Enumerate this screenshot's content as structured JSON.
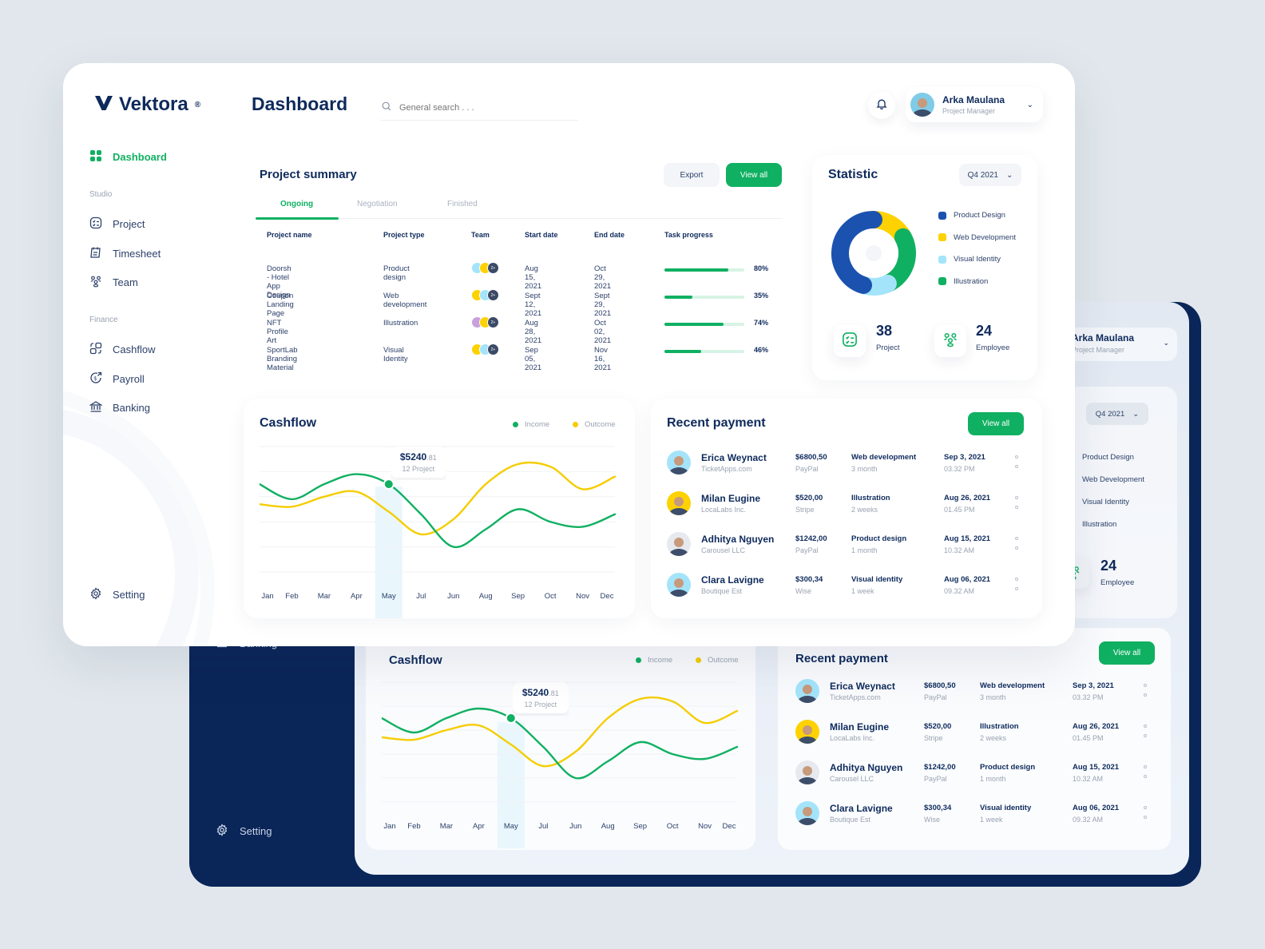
{
  "brand": {
    "name": "Vektora",
    "mark": "®"
  },
  "header": {
    "title": "Dashboard",
    "search_placeholder": "General search . . .",
    "user": {
      "name": "Arka Maulana",
      "role": "Project Manager"
    }
  },
  "sidebar": {
    "active": {
      "label": "Dashboard"
    },
    "sections": [
      {
        "label": "Studio",
        "items": [
          {
            "label": "Project"
          },
          {
            "label": "Timesheet"
          },
          {
            "label": "Team"
          }
        ]
      },
      {
        "label": "Finance",
        "items": [
          {
            "label": "Cashflow"
          },
          {
            "label": "Payroll"
          },
          {
            "label": "Banking"
          }
        ]
      }
    ],
    "setting": {
      "label": "Setting"
    }
  },
  "project_summary": {
    "title": "Project summary",
    "export_label": "Export",
    "view_all_label": "View all",
    "tabs": [
      {
        "label": "Ongoing"
      },
      {
        "label": "Negotiation"
      },
      {
        "label": "Finished"
      }
    ],
    "columns": [
      "Project name",
      "Project type",
      "Team",
      "Start date",
      "End date",
      "Task progress"
    ],
    "rows": [
      {
        "name": "Doorsh - Hotel App Design",
        "type": "Product design",
        "team_more": "2+",
        "start": "Aug 15, 2021",
        "end": "Oct 29, 2021",
        "progress": 80,
        "progress_label": "80%"
      },
      {
        "name": "Coupon Landing Page",
        "type": "Web development",
        "team_more": "2+",
        "start": "Sept 12, 2021",
        "end": "Sept 29, 2021",
        "progress": 35,
        "progress_label": "35%"
      },
      {
        "name": "NFT Profile Art",
        "type": "Illustration",
        "team_more": "2+",
        "start": "Aug 28, 2021",
        "end": "Oct 02, 2021",
        "progress": 74,
        "progress_label": "74%"
      },
      {
        "name": "SportLab Branding Material",
        "type": "Visual Identity",
        "team_more": "2+",
        "start": "Sep 05, 2021",
        "end": "Nov 16, 2021",
        "progress": 46,
        "progress_label": "46%"
      }
    ]
  },
  "statistic": {
    "title": "Statistic",
    "period": "Q4 2021",
    "segments": [
      {
        "label": "Product Design",
        "share": 45,
        "color": "#1b52b0"
      },
      {
        "label": "Web Development",
        "share": 17,
        "color": "#fdd200"
      },
      {
        "label": "Visual Identity",
        "share": 12,
        "color": "#a4e4fb"
      },
      {
        "label": "Illustration",
        "share": 26,
        "color": "#10b062"
      }
    ],
    "segment_order_clockwise_from_top": [
      "Web Development",
      "Illustration",
      "Visual Identity",
      "Product Design"
    ],
    "kpis": [
      {
        "value": "38",
        "label": "Project"
      },
      {
        "value": "24",
        "label": "Employee"
      }
    ]
  },
  "cashflow": {
    "title": "Cashflow",
    "legend": [
      {
        "label": "Income",
        "color": "#10b062"
      },
      {
        "label": "Outcome",
        "color": "#f5cd00"
      }
    ],
    "tooltip": {
      "value_main": "$5240",
      "value_cents": ".81",
      "sub": "12 Project",
      "month_index": 4
    }
  },
  "chart_data": {
    "type": "line",
    "title": "Cashflow",
    "xlabel": "",
    "ylabel": "",
    "categories": [
      "Jan",
      "Feb",
      "Mar",
      "Apr",
      "May",
      "Jul",
      "Jun",
      "Aug",
      "Sep",
      "Oct",
      "Nov",
      "Dec"
    ],
    "ylim": [
      0,
      5
    ],
    "grid": true,
    "legend": "top-right",
    "series": [
      {
        "name": "Income",
        "color": "#10b062",
        "values": [
          3.5,
          2.9,
          3.5,
          3.9,
          3.5,
          2.3,
          1.0,
          1.7,
          2.5,
          2.0,
          1.8,
          2.3
        ]
      },
      {
        "name": "Outcome",
        "color": "#f5cd00",
        "values": [
          2.7,
          2.6,
          3.0,
          3.2,
          2.4,
          1.5,
          2.1,
          3.5,
          4.3,
          4.2,
          3.3,
          3.8
        ]
      }
    ],
    "highlight": {
      "category": "May",
      "series": "Income",
      "label": "$5240.81",
      "sublabel": "12 Project"
    }
  },
  "recent_payment": {
    "title": "Recent payment",
    "view_all_label": "View all",
    "rows": [
      {
        "name": "Erica Weynact",
        "company": "TicketApps.com",
        "amount": "$6800,50",
        "method": "PayPal",
        "type": "Web development",
        "duration": "3 month",
        "date": "Sep 3, 2021",
        "time": "03.32 PM",
        "avatar_bg": "#a4e4fb"
      },
      {
        "name": "Milan Eugine",
        "company": "LocaLabs Inc.",
        "amount": "$520,00",
        "method": "Stripe",
        "type": "Illustration",
        "duration": "2 weeks",
        "date": "Aug 26, 2021",
        "time": "01.45 PM",
        "avatar_bg": "#fdd200"
      },
      {
        "name": "Adhitya Nguyen",
        "company": "Carousel LLC",
        "amount": "$1242,00",
        "method": "PayPal",
        "type": "Product design",
        "duration": "1 month",
        "date": "Aug 15, 2021",
        "time": "10.32 AM",
        "avatar_bg": "#e6e9ee"
      },
      {
        "name": "Clara Lavigne",
        "company": "Boutique Est",
        "amount": "$300,34",
        "method": "Wise",
        "type": "Visual identity",
        "duration": "1 week",
        "date": "Aug 06, 2021",
        "time": "09.32 AM",
        "avatar_bg": "#a4e4fb"
      }
    ]
  }
}
